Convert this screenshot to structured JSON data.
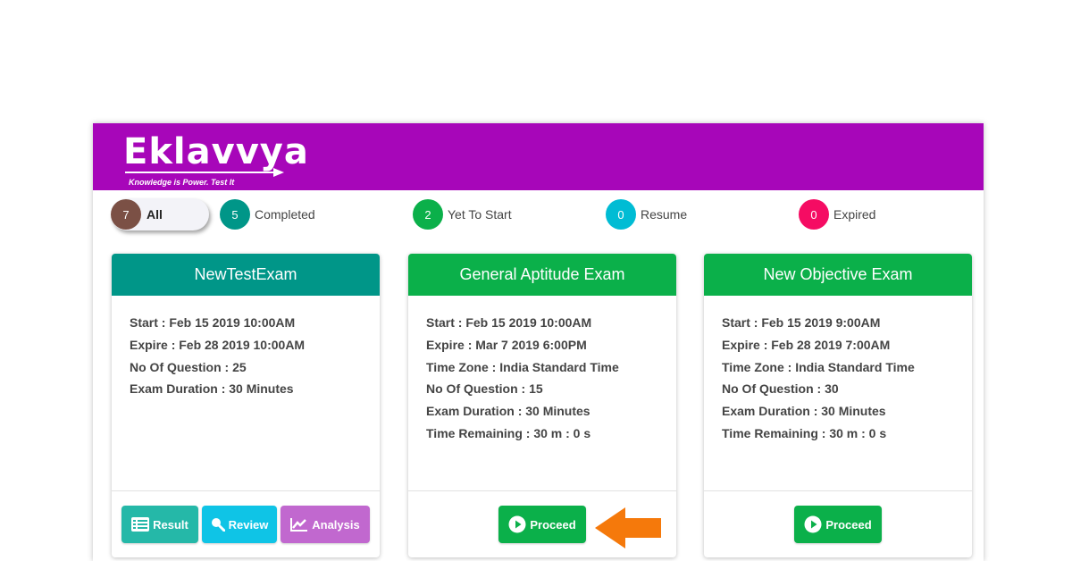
{
  "brand": {
    "name": "Eklavvya",
    "tagline": "Knowledge is Power. Test It",
    "header_color": "#a706b9"
  },
  "filters": [
    {
      "count": "7",
      "label": "All",
      "color": "#7b5045",
      "active": true
    },
    {
      "count": "5",
      "label": "Completed",
      "color": "#009688",
      "active": false
    },
    {
      "count": "2",
      "label": "Yet To Start",
      "color": "#0bb04a",
      "active": false
    },
    {
      "count": "0",
      "label": "Resume",
      "color": "#00bcd4",
      "active": false
    },
    {
      "count": "0",
      "label": "Expired",
      "color": "#f50c63",
      "active": false
    }
  ],
  "exams": [
    {
      "title": "NewTestExam",
      "header_color": "#009688",
      "details": [
        "Start : Feb 15 2019 10:00AM",
        "Expire : Feb 28 2019 10:00AM",
        "No Of Question : 25",
        "Exam Duration : 30 Minutes"
      ],
      "actions": [
        {
          "label": "Result",
          "icon": "list-icon",
          "color": "#25b8a8"
        },
        {
          "label": "Review",
          "icon": "magnifier-icon",
          "color": "#0fc4e6"
        },
        {
          "label": "Analysis",
          "icon": "line-chart-icon",
          "color": "#c168cf"
        }
      ]
    },
    {
      "title": "General Aptitude Exam",
      "header_color": "#0bb04a",
      "details": [
        "Start : Feb 15 2019 10:00AM",
        "Expire : Mar 7 2019 6:00PM",
        "Time Zone : India Standard Time",
        "No Of Question : 15",
        "Exam Duration : 30 Minutes",
        "Time Remaining : 30 m : 0 s"
      ],
      "actions": [
        {
          "label": "Proceed",
          "icon": "play-circle-icon",
          "color": "#0bb04a"
        }
      ]
    },
    {
      "title": "New Objective Exam",
      "header_color": "#0bb04a",
      "details": [
        "Start : Feb 15 2019 9:00AM",
        "Expire : Feb 28 2019 7:00AM",
        "Time Zone : India Standard Time",
        "No Of Question : 30",
        "Exam Duration : 30 Minutes",
        "Time Remaining : 30 m : 0 s"
      ],
      "actions": [
        {
          "label": "Proceed",
          "icon": "play-circle-icon",
          "color": "#0bb04a"
        }
      ]
    }
  ],
  "pointer": {
    "icon": "arrow-left-icon",
    "color": "#f5790b"
  }
}
